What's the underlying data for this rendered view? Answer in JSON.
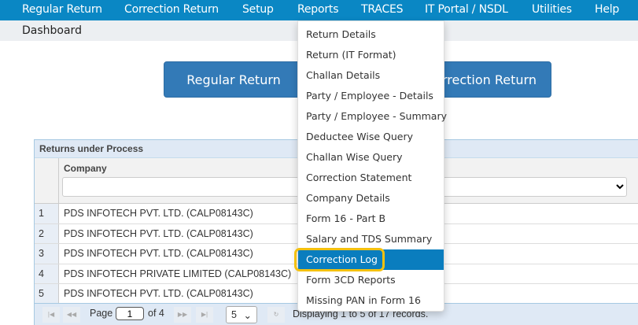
{
  "menu": [
    "Regular Return",
    "Correction Return",
    "Setup",
    "Reports",
    "TRACES",
    "IT Portal / NSDL",
    "Utilities",
    "Help"
  ],
  "breadcrumb": "Dashboard",
  "buttons": {
    "regular": "Regular Return",
    "correction": "Correction Return"
  },
  "grid": {
    "title": "Returns under Process",
    "column": "Company",
    "rows": [
      {
        "n": "1",
        "company": "PDS INFOTECH PVT. LTD. (CALP08143C)"
      },
      {
        "n": "2",
        "company": "PDS INFOTECH PVT. LTD. (CALP08143C)"
      },
      {
        "n": "3",
        "company": "PDS INFOTECH PVT. LTD. (CALP08143C)"
      },
      {
        "n": "4",
        "company": "PDS INFOTECH PRIVATE LIMITED (CALP08143C)"
      },
      {
        "n": "5",
        "company": "PDS INFOTECH PVT. LTD. (CALP08143C)"
      }
    ],
    "pager": {
      "page_label": "Page",
      "page": "1",
      "of": "of 4",
      "page_size": "5",
      "records": "Displaying 1 to 5 of 17 records."
    }
  },
  "reports_menu": [
    "Return Details",
    "Return (IT Format)",
    "Challan Details",
    "Party / Employee - Details",
    "Party / Employee - Summary",
    "Deductee Wise Query",
    "Challan Wise Query",
    "Correction Statement",
    "Company Details",
    "Form 16 - Part B",
    "Salary and TDS Summary",
    "Correction Log",
    "Form 3CD Reports",
    "Missing PAN in Form 16"
  ],
  "colors": {
    "menubar": "#0a87c4",
    "button": "#337ab7",
    "highlight": "#f4c10f"
  }
}
